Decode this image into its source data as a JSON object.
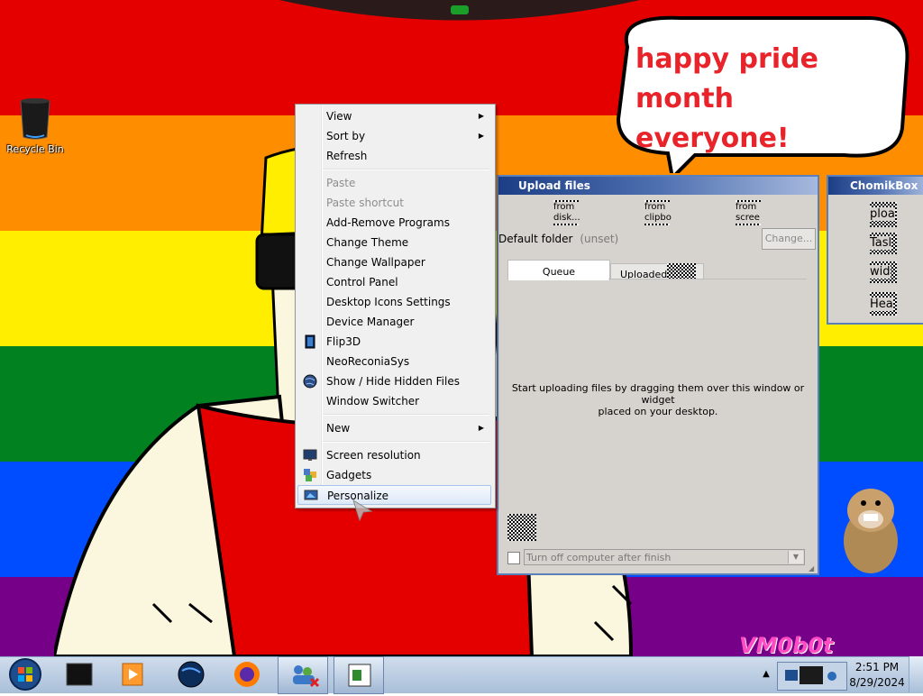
{
  "desktop": {
    "recycle_bin_label": "Recycle Bin",
    "speech_bubble": [
      "happy pride month",
      "everyone!"
    ],
    "watermark": "VM0b0t",
    "flag_colors": [
      "#e50000",
      "#ff8d00",
      "#ffee00",
      "#028121",
      "#004cff",
      "#770088"
    ]
  },
  "context_menu": {
    "items": [
      {
        "label": "View",
        "submenu": true
      },
      {
        "label": "Sort by",
        "submenu": true
      },
      {
        "label": "Refresh"
      },
      {
        "label": "Paste",
        "disabled": true
      },
      {
        "label": "Paste shortcut",
        "disabled": true
      },
      {
        "label": "Add-Remove Programs"
      },
      {
        "label": "Change Theme"
      },
      {
        "label": "Change Wallpaper"
      },
      {
        "label": "Control Panel"
      },
      {
        "label": "Desktop Icons Settings"
      },
      {
        "label": "Device Manager"
      },
      {
        "label": "Flip3D",
        "icon": "flip3d-icon"
      },
      {
        "label": "NeoReconiaSys"
      },
      {
        "label": "Show / Hide Hidden Files",
        "icon": "globe-icon"
      },
      {
        "label": "Window Switcher"
      },
      {
        "label": "New",
        "submenu": true
      },
      {
        "label": "Screen resolution",
        "icon": "monitor-icon"
      },
      {
        "label": "Gadgets",
        "icon": "gadgets-icon"
      },
      {
        "label": "Personalize",
        "icon": "personalize-icon",
        "highlighted": true
      }
    ]
  },
  "upload_window": {
    "title": "Upload files",
    "source_buttons": [
      "from disk...",
      "from clipbo",
      "from scree"
    ],
    "default_folder_label": "Default folder",
    "default_folder_value": "(unset)",
    "change_button": "Change...",
    "tabs": [
      "Queue",
      "Uploaded"
    ],
    "hint_line1": "Start uploading files by dragging them over this window or widget",
    "hint_line2": "placed on your desktop.",
    "shutdown_option": "Turn off computer after finish"
  },
  "chomikbox_window": {
    "title": "ChomikBox",
    "buttons": [
      "ploa",
      "Tasl",
      "wid",
      "Hea"
    ]
  },
  "taskbar": {
    "time": "2:51 PM",
    "date": "8/29/2024",
    "tray_arrow": "▲"
  }
}
